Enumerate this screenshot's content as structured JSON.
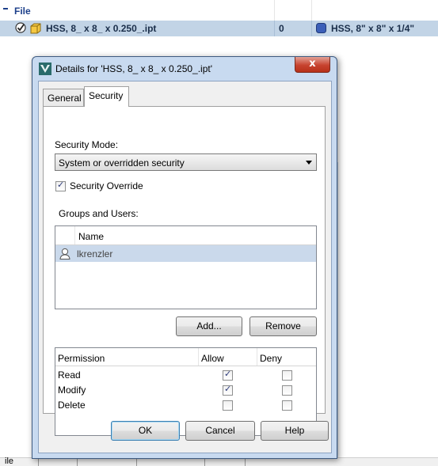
{
  "background": {
    "section_title": "File",
    "row": {
      "name": "HSS, 8_ x 8_ x 0.250_.ipt",
      "count": "0",
      "description": "HSS, 8\" x 8\" x 1/4\""
    },
    "bottom_tab": "ile"
  },
  "dialog": {
    "title": "Details for 'HSS, 8_ x 8_ x 0.250_.ipt'",
    "close_label": "x",
    "tabs": [
      {
        "label": "General",
        "active": false
      },
      {
        "label": "Security",
        "active": true
      }
    ],
    "security_mode_label": "Security Mode:",
    "security_mode_value": "System or overridden security",
    "security_override_label": "Security Override",
    "security_override_checked": true,
    "groups_users_label": "Groups and Users:",
    "users_column": "Name",
    "users": [
      {
        "name": "lkrenzler",
        "selected": true
      }
    ],
    "add_label": "Add...",
    "remove_label": "Remove",
    "permissions_headers": {
      "permission": "Permission",
      "allow": "Allow",
      "deny": "Deny"
    },
    "permissions": [
      {
        "name": "Read",
        "allow": true,
        "deny": false
      },
      {
        "name": "Modify",
        "allow": true,
        "deny": false
      },
      {
        "name": "Delete",
        "allow": false,
        "deny": false
      }
    ],
    "ok_label": "OK",
    "cancel_label": "Cancel",
    "help_label": "Help"
  },
  "colors": {
    "selection_row": "#c2d4e6",
    "dialog_frame": "#c8daf0",
    "close_red": "#c7432f",
    "checkmark": "#2c3a7a"
  },
  "icons": [
    "check-status-icon",
    "part-file-icon",
    "material-icon",
    "app-logo-icon",
    "user-icon",
    "dropdown-arrow-icon"
  ]
}
